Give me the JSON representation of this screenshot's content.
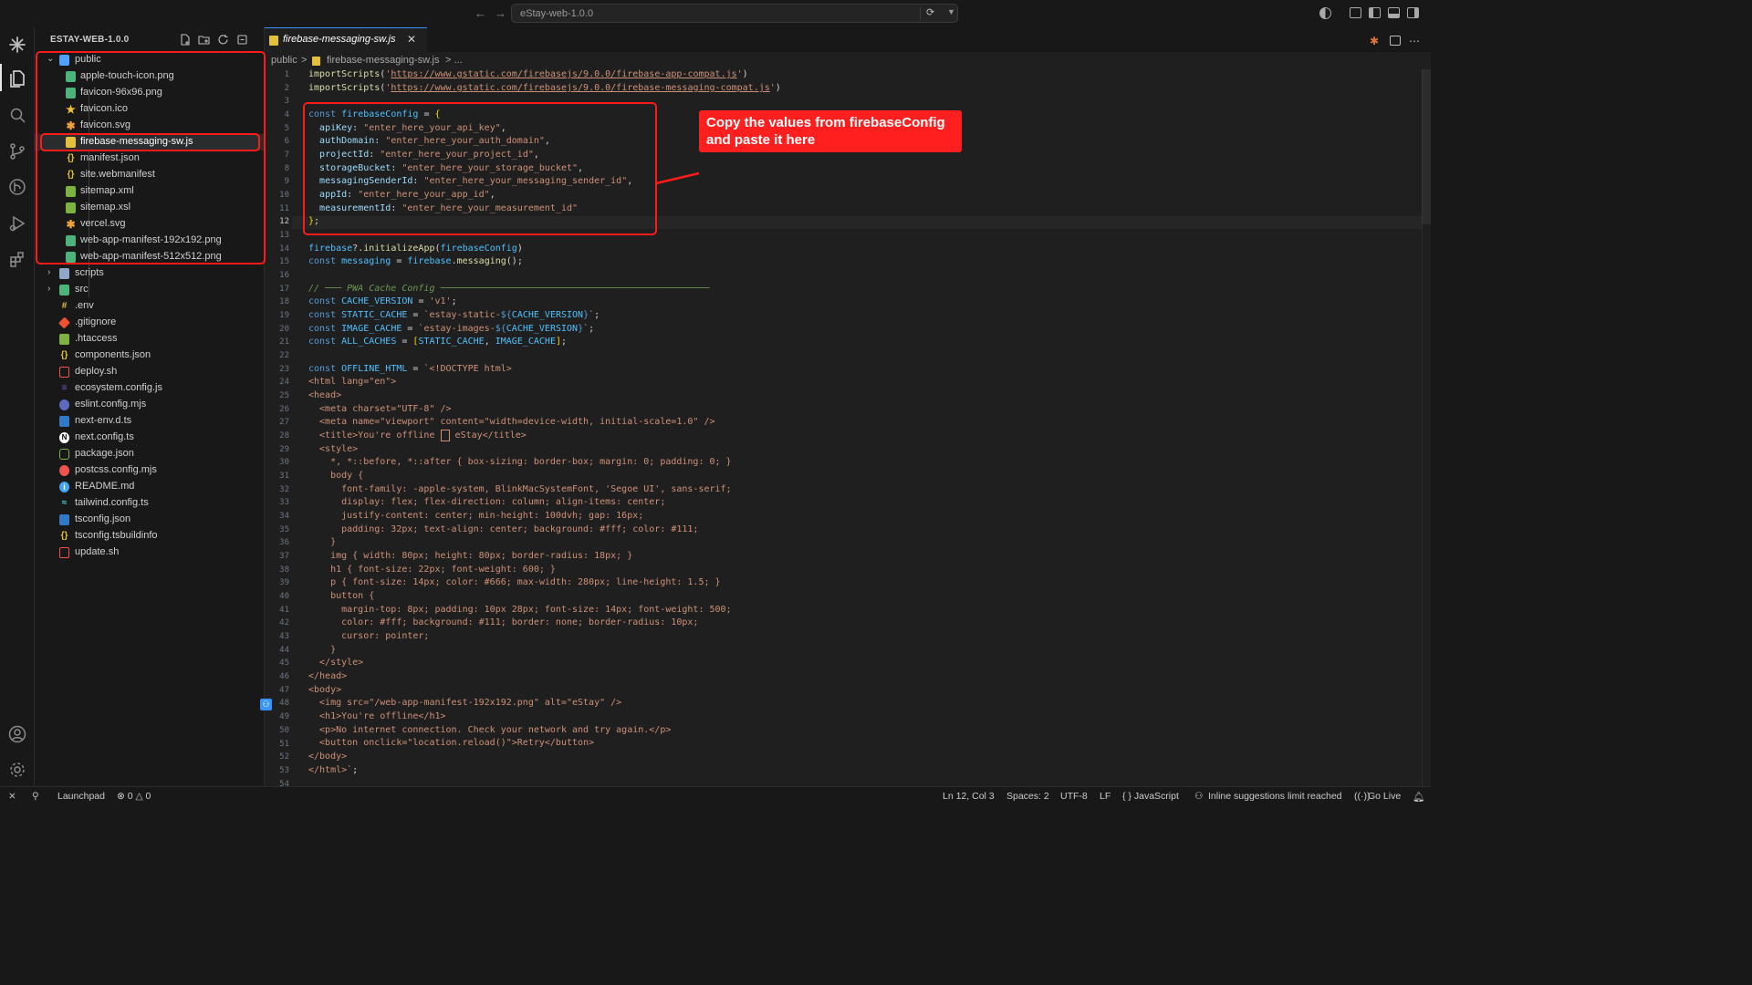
{
  "titlebar": {
    "back": "←",
    "forward": "→",
    "search_text": "eStay-web-1.0.0"
  },
  "sidebar": {
    "title": "ESTAY-WEB-1.0.0",
    "items": [
      {
        "label": "public",
        "type": "folder-open",
        "depth": 0,
        "icon_color": "#4ea1ff"
      },
      {
        "label": "apple-touch-icon.png",
        "type": "file",
        "depth": 1,
        "icon_color": "#4db37a"
      },
      {
        "label": "favicon-96x96.png",
        "type": "file",
        "depth": 1,
        "icon_color": "#4db37a"
      },
      {
        "label": "favicon.ico",
        "type": "file",
        "depth": 1,
        "icon_color": "#f2c12e"
      },
      {
        "label": "favicon.svg",
        "type": "file",
        "depth": 1,
        "icon_color": "#f4a13a"
      },
      {
        "label": "firebase-messaging-sw.js",
        "type": "file",
        "depth": 1,
        "icon_color": "#e5c03a"
      },
      {
        "label": "manifest.json",
        "type": "file",
        "depth": 1,
        "icon_color": "#e5c03a"
      },
      {
        "label": "site.webmanifest",
        "type": "file",
        "depth": 1,
        "icon_color": "#e5c03a"
      },
      {
        "label": "sitemap.xml",
        "type": "file",
        "depth": 1,
        "icon_color": "#7cb342"
      },
      {
        "label": "sitemap.xsl",
        "type": "file",
        "depth": 1,
        "icon_color": "#7cb342"
      },
      {
        "label": "vercel.svg",
        "type": "file",
        "depth": 1,
        "icon_color": "#f4a13a"
      },
      {
        "label": "web-app-manifest-192x192.png",
        "type": "file",
        "depth": 1,
        "icon_color": "#4db37a"
      },
      {
        "label": "web-app-manifest-512x512.png",
        "type": "file",
        "depth": 1,
        "icon_color": "#4db37a"
      },
      {
        "label": "scripts",
        "type": "folder",
        "depth": 0,
        "icon_color": "#8fa8c8"
      },
      {
        "label": "src",
        "type": "folder",
        "depth": 0,
        "icon_color": "#4db37a"
      },
      {
        "label": ".env",
        "type": "file",
        "depth": 0,
        "icon_color": "#e5c03a"
      },
      {
        "label": ".gitignore",
        "type": "file",
        "depth": 0,
        "icon_color": "#f05133"
      },
      {
        "label": ".htaccess",
        "type": "file",
        "depth": 0,
        "icon_color": "#7cb342"
      },
      {
        "label": "components.json",
        "type": "file",
        "depth": 0,
        "icon_color": "#e5c03a"
      },
      {
        "label": "deploy.sh",
        "type": "file",
        "depth": 0,
        "icon_color": "#ef5350"
      },
      {
        "label": "ecosystem.config.js",
        "type": "file",
        "depth": 0,
        "icon_color": "#7e57c2"
      },
      {
        "label": "eslint.config.mjs",
        "type": "file",
        "depth": 0,
        "icon_color": "#5c6bc0"
      },
      {
        "label": "next-env.d.ts",
        "type": "file",
        "depth": 0,
        "icon_color": "#3178c6"
      },
      {
        "label": "next.config.ts",
        "type": "file",
        "depth": 0,
        "icon_color": "#ffffff"
      },
      {
        "label": "package.json",
        "type": "file",
        "depth": 0,
        "icon_color": "#7cb342"
      },
      {
        "label": "postcss.config.mjs",
        "type": "file",
        "depth": 0,
        "icon_color": "#ef5350"
      },
      {
        "label": "README.md",
        "type": "file",
        "depth": 0,
        "icon_color": "#42a5f5"
      },
      {
        "label": "tailwind.config.ts",
        "type": "file",
        "depth": 0,
        "icon_color": "#4dd0e1"
      },
      {
        "label": "tsconfig.json",
        "type": "file",
        "depth": 0,
        "icon_color": "#3178c6"
      },
      {
        "label": "tsconfig.tsbuildinfo",
        "type": "file",
        "depth": 0,
        "icon_color": "#e5c03a"
      },
      {
        "label": "update.sh",
        "type": "file",
        "depth": 0,
        "icon_color": "#ef5350"
      }
    ]
  },
  "editor": {
    "tab_label": "firebase-messaging-sw.js",
    "tab_close": "✕",
    "breadcrumb": [
      "public",
      ">",
      "firebase-messaging-sw.js",
      "> ..."
    ],
    "current_line": 12,
    "line_numbers": [
      "1",
      "2",
      "3",
      "4",
      "5",
      "6",
      "7",
      "8",
      "9",
      "10",
      "11",
      "12",
      "13",
      "14",
      "15",
      "16",
      "17",
      "18",
      "19",
      "20",
      "21",
      "22",
      "23",
      "24",
      "25",
      "26",
      "27",
      "28",
      "29",
      "30",
      "31",
      "32",
      "33",
      "34",
      "35",
      "36",
      "37",
      "38",
      "39",
      "40",
      "41",
      "42",
      "43",
      "44",
      "45",
      "46",
      "47",
      "48",
      "49",
      "50",
      "51",
      "52",
      "53",
      "54"
    ]
  },
  "annotation": {
    "callout": "Copy the values from firebaseConfig and paste it here"
  },
  "statusbar": {
    "remote_icon": "⨯",
    "launchpad": "Launchpad",
    "problems": "⊗ 0 △ 0",
    "position": "Ln 12, Col 3",
    "spaces": "Spaces: 2",
    "encoding": "UTF-8",
    "eol": "LF",
    "language": "{ } JavaScript",
    "copilot": "Inline suggestions limit reached",
    "golive": "Go Live"
  },
  "colors": {
    "accent": "#3794ff",
    "annotation_red": "#ff1a1a",
    "editor_bg": "#1f1f1f",
    "sidebar_bg": "#181818"
  }
}
